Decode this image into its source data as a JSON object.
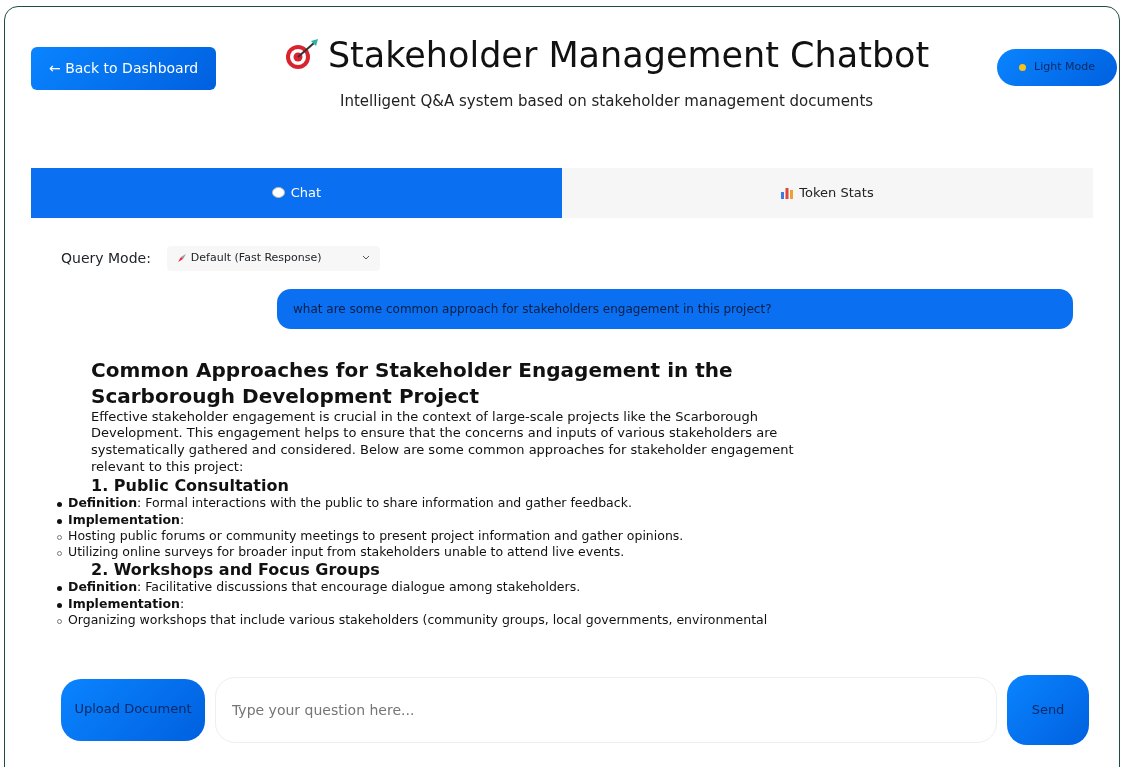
{
  "header": {
    "back_button": "← Back to Dashboard",
    "title": "Stakeholder Management Chatbot",
    "subtitle": "Intelligent Q&A system based on stakeholder management documents",
    "theme_button": "Light Mode"
  },
  "tabs": [
    {
      "label": "Chat",
      "kind": "chat",
      "selected": true
    },
    {
      "label": "Token Stats",
      "kind": "chart",
      "selected": false
    }
  ],
  "query_mode": {
    "label": "Query Mode:",
    "value": "Default (Fast Response)"
  },
  "messages": [
    {
      "kind": "user",
      "text": "what are some common approach for stakeholders engagement in this project?"
    },
    {
      "kind": "bot",
      "blocks": [
        {
          "kind": "heading",
          "text": "Common Approaches for Stakeholder Engagement in the Scarborough Development Project"
        },
        {
          "kind": "paragraph",
          "text": "Effective stakeholder engagement is crucial in the context of large-scale projects like the Scarborough Development. This engagement helps to ensure that the concerns and inputs of various stakeholders are systematically gathered and considered. Below are some common approaches for stakeholder engagement relevant to this project:"
        },
        {
          "kind": "section",
          "text": "1. Public Consultation"
        },
        {
          "kind": "bullet",
          "text": "**Definition**: Formal interactions with the public to share information and gather feedback."
        },
        {
          "kind": "bullet",
          "text": "**Implementation**:"
        },
        {
          "kind": "subbullet",
          "text": "Hosting public forums or community meetings to present project information and gather opinions."
        },
        {
          "kind": "subbullet",
          "text": "Utilizing online surveys for broader input from stakeholders unable to attend live events."
        },
        {
          "kind": "section",
          "text": "2. Workshops and Focus Groups"
        },
        {
          "kind": "bullet",
          "text": "**Definition**: Facilitative discussions that encourage dialogue among stakeholders."
        },
        {
          "kind": "bullet",
          "text": "**Implementation**:"
        },
        {
          "kind": "subbullet",
          "text": "Organizing workshops that include various stakeholders (community groups, local governments, environmental"
        }
      ]
    }
  ],
  "composer": {
    "upload_button": "Upload Document",
    "placeholder": "Type your question here...",
    "send_button": "Send"
  }
}
